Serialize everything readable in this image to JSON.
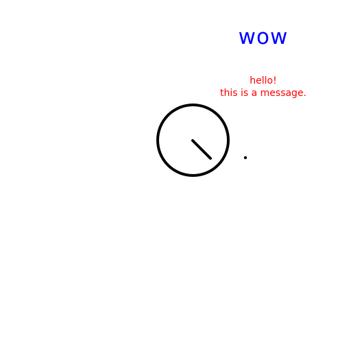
{
  "heading": {
    "text": "wow",
    "color": "#0000ff"
  },
  "message": {
    "lines": [
      "hello!",
      "this is a message."
    ],
    "color": "#ff0000"
  },
  "dial": {
    "stroke_color": "#000000",
    "hand_direction": "lower-right"
  },
  "dot": {
    "color": "#000000"
  }
}
